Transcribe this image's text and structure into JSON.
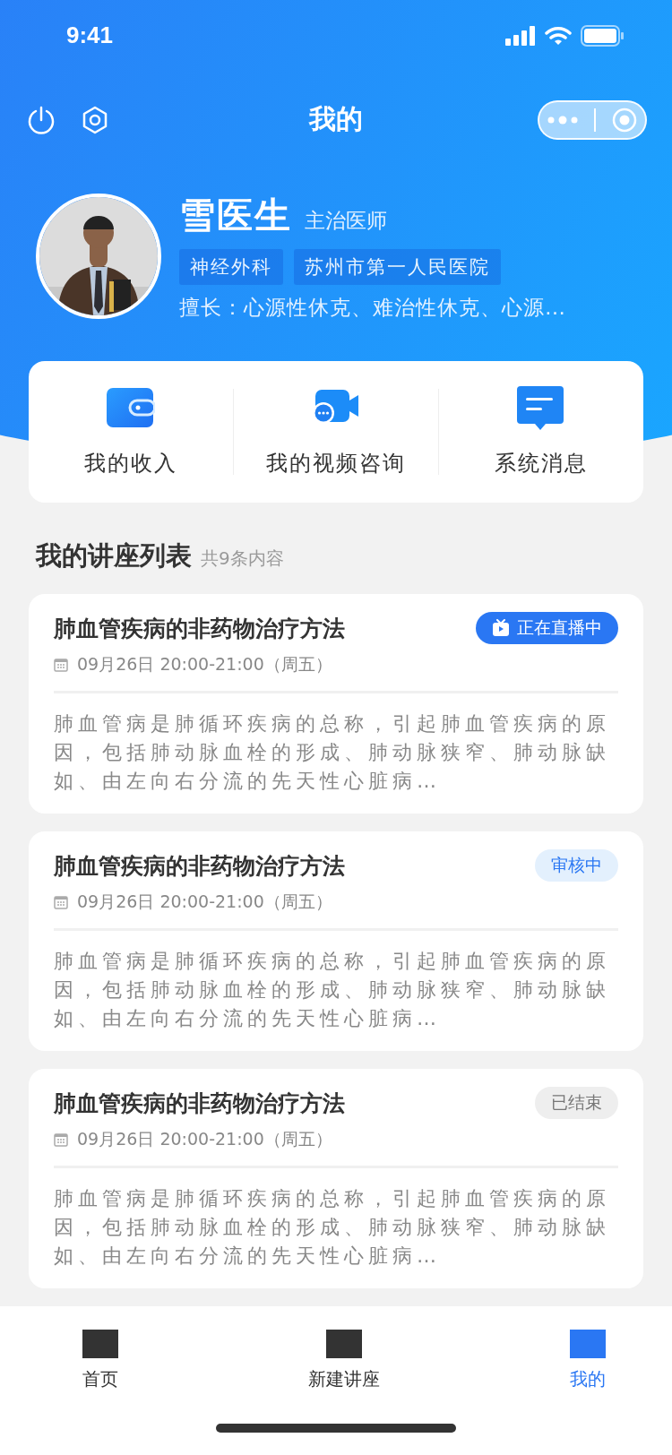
{
  "status_bar": {
    "time": "9:41"
  },
  "nav": {
    "title": "我的"
  },
  "profile": {
    "name": "雪医生",
    "title": "主治医师",
    "tags": [
      "神经外科",
      "苏州市第一人民医院"
    ],
    "specialty": "擅长：心源性休克、难治性休克、心源…"
  },
  "quick_menu": [
    {
      "kind": "wallet",
      "label": "我的收入"
    },
    {
      "kind": "video",
      "label": "我的视频咨询"
    },
    {
      "kind": "message",
      "label": "系统消息"
    }
  ],
  "lectures": {
    "title": "我的讲座列表",
    "count": "共9条内容",
    "items": [
      {
        "title": "肺血管疾病的非药物治疗方法",
        "status": {
          "kind": "live",
          "label": "正在直播中"
        },
        "time": "09月26日 20:00-21:00（周五）",
        "description": "肺血管病是肺循环疾病的总称，引起肺血管疾病的原因，包括肺动脉血栓的形成、肺动脉狭窄、肺动脉缺如、由左向右分流的先天性心脏病…"
      },
      {
        "title": "肺血管疾病的非药物治疗方法",
        "status": {
          "kind": "review",
          "label": "审核中"
        },
        "time": "09月26日 20:00-21:00（周五）",
        "description": "肺血管病是肺循环疾病的总称，引起肺血管疾病的原因，包括肺动脉血栓的形成、肺动脉狭窄、肺动脉缺如、由左向右分流的先天性心脏病…"
      },
      {
        "title": "肺血管疾病的非药物治疗方法",
        "status": {
          "kind": "ended",
          "label": "已结束"
        },
        "time": "09月26日 20:00-21:00（周五）",
        "description": "肺血管病是肺循环疾病的总称，引起肺血管疾病的原因，包括肺动脉血栓的形成、肺动脉狭窄、肺动脉缺如、由左向右分流的先天性心脏病…"
      }
    ]
  },
  "tab_bar": [
    {
      "label": "首页",
      "selected": false
    },
    {
      "label": "新建讲座",
      "selected": false
    },
    {
      "label": "我的",
      "selected": true
    }
  ]
}
